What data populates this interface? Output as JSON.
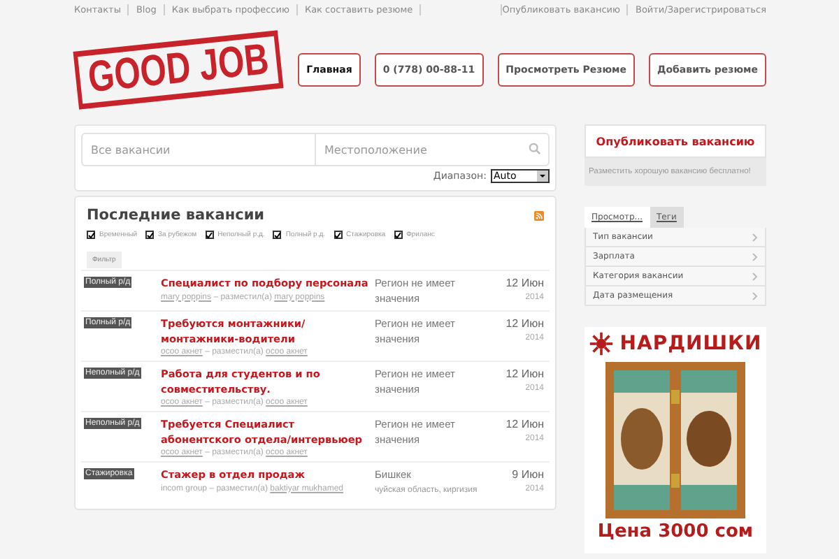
{
  "top_links_left": [
    "Контакты",
    "Blog",
    "Как выбрать профессию",
    "Как составить резюме"
  ],
  "top_links_right": [
    "Опубликовать вакансию",
    "Войти/Зарегистрироваться"
  ],
  "logo": "GOOD JOB",
  "nav": [
    {
      "label": "Главная",
      "selected": true
    },
    {
      "label": "0 (778) 00-88-11",
      "selected": false
    },
    {
      "label": "Просмотреть Резюме",
      "selected": false
    },
    {
      "label": "Добавить резюме",
      "selected": false
    }
  ],
  "search": {
    "keywords_placeholder": "Все вакансии",
    "location_placeholder": "Местоположение",
    "range_label": "Диапазон:",
    "range_value": "Auto"
  },
  "jobs": {
    "title": "Последние вакансии",
    "filters": [
      {
        "label": "Временный",
        "checked": true
      },
      {
        "label": "За рубежом",
        "checked": true
      },
      {
        "label": "Неполный р.д.",
        "checked": true
      },
      {
        "label": "Полный р.д.",
        "checked": true
      },
      {
        "label": "Стажировка",
        "checked": true
      },
      {
        "label": "Фриланс",
        "checked": true
      }
    ],
    "filter_button": "Фильтр",
    "rows": [
      {
        "type": "Полный р/д",
        "title": "Специалист по подбору персонала",
        "company": "mary poppins",
        "posted_by": "– разместил(а)",
        "author": "mary poppins",
        "company_link": true,
        "location": "Регион не имеет значения",
        "region": "",
        "date": "12 Июн",
        "year": "2014"
      },
      {
        "type": "Полный р/д",
        "title": "Требуются монтажники/монтажники-водители",
        "company": "осоо акнет",
        "posted_by": "– разместил(а)",
        "author": "осоо акнет",
        "company_link": true,
        "location": "Регион не имеет значения",
        "region": "",
        "date": "12 Июн",
        "year": "2014"
      },
      {
        "type": "Неполный р/д",
        "title": "Работа для студентов и по совместительству.",
        "company": "осоо акнет",
        "posted_by": "– разместил(а)",
        "author": "осоо акнет",
        "company_link": true,
        "location": "Регион не имеет значения",
        "region": "",
        "date": "12 Июн",
        "year": "2014"
      },
      {
        "type": "Неполный р/д",
        "title": "Требуется Специалист абонентского отдела/интервьюер",
        "company": "осоо акнет",
        "posted_by": "– разместил(а)",
        "author": "осоо акнет",
        "company_link": true,
        "location": "Регион не имеет значения",
        "region": "",
        "date": "12 Июн",
        "year": "2014"
      },
      {
        "type": "Стажировка",
        "title": "Стажер в отдел продаж",
        "company": "incom group",
        "posted_by": "– разместил(а)",
        "author": "baktiyar mukhamed",
        "company_link": false,
        "location": "Бишкек",
        "region": "чуйская область, киргизия",
        "date": "9 Июн",
        "year": "2014"
      }
    ]
  },
  "sidebar": {
    "publish_button": "Опубликовать вакансию",
    "publish_note": "Разместить хорошую вакансию бесплатно!",
    "tabs": [
      {
        "label": "Просмотр...",
        "selected": true
      },
      {
        "label": "Теги",
        "selected": false
      }
    ],
    "browse_items": [
      "Тип вакансии",
      "Зарплата",
      "Категория вакансии",
      "Дата размещения"
    ],
    "ad": {
      "headline": "НАРДИШКИ",
      "price": "Цена 3000 сом"
    }
  }
}
